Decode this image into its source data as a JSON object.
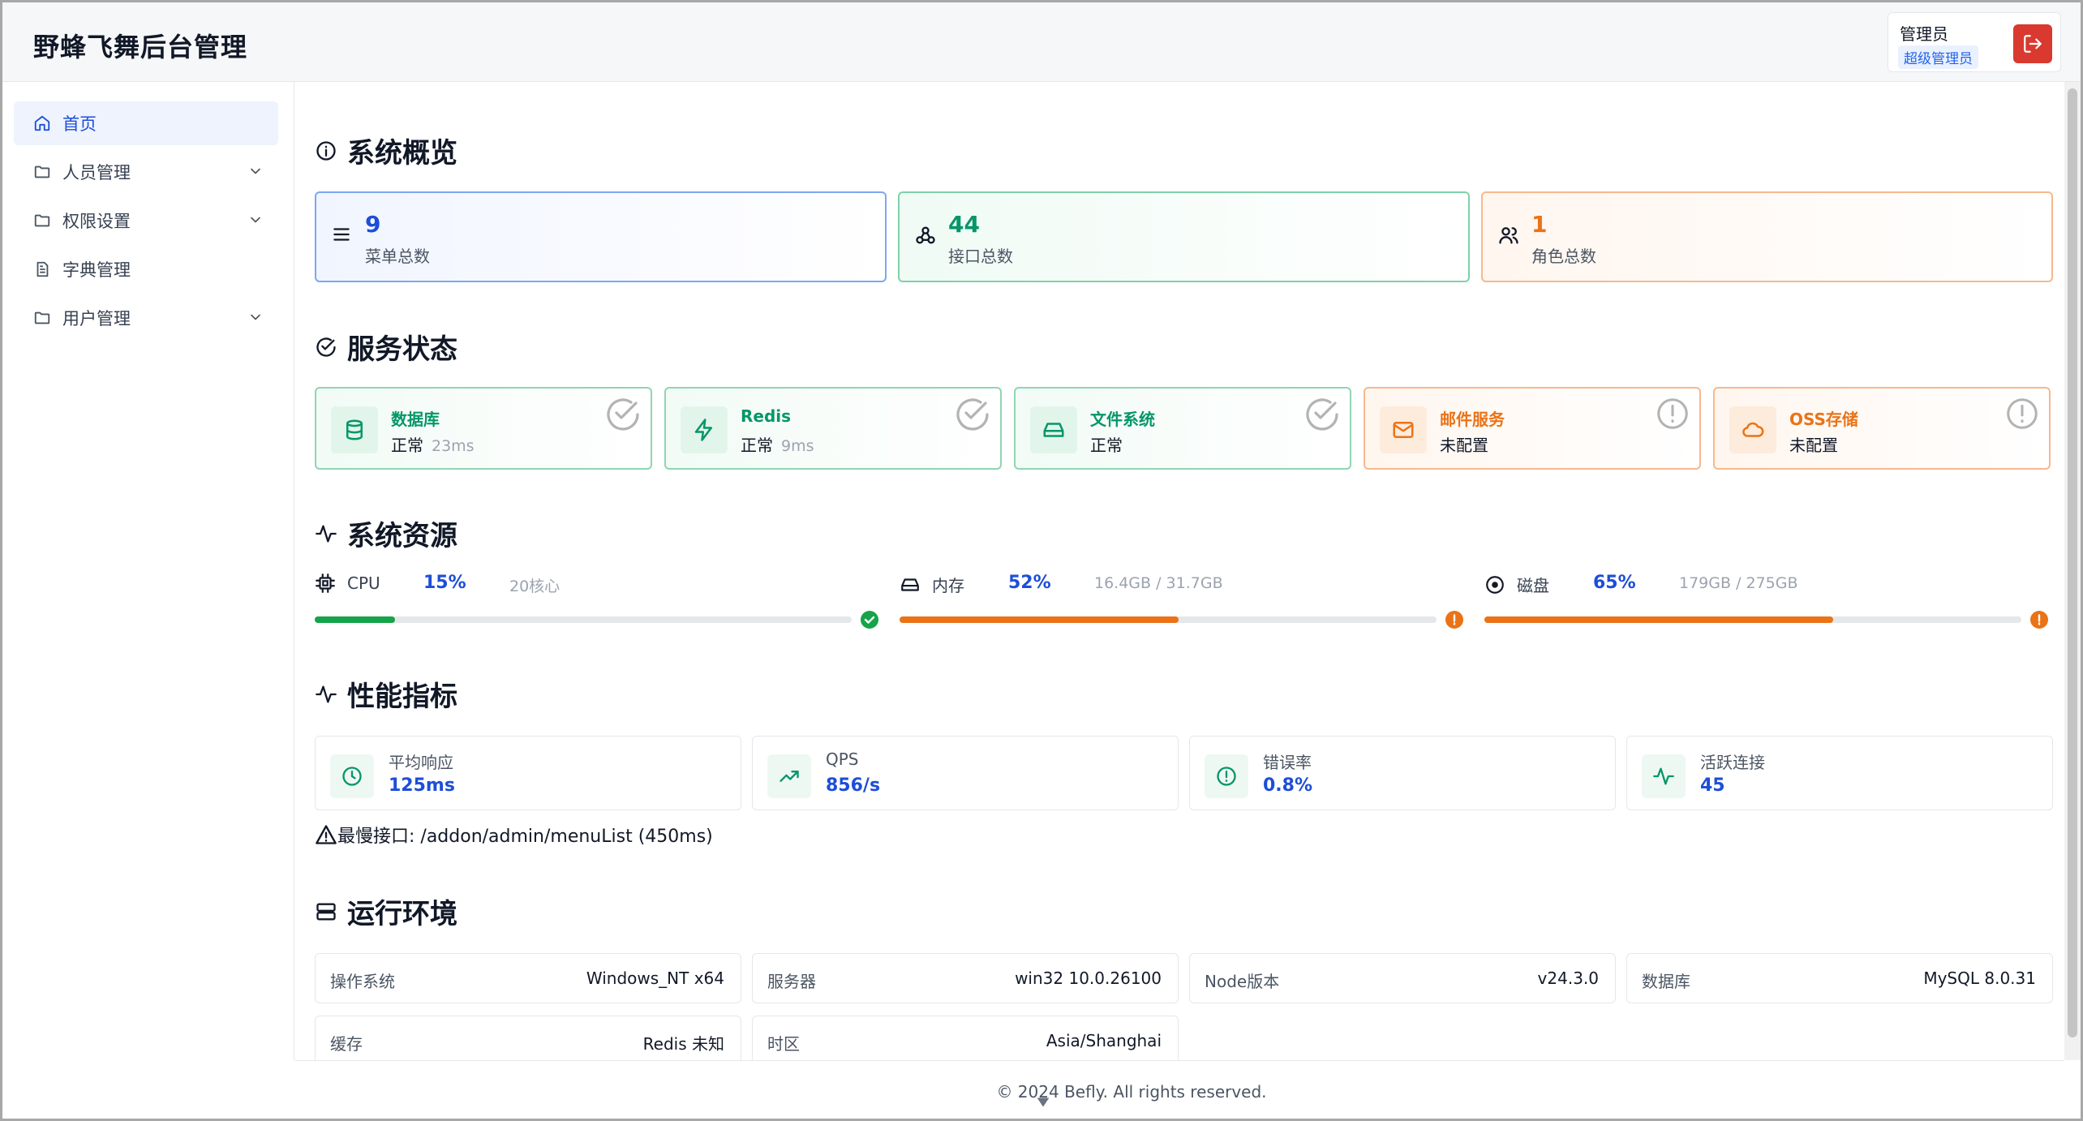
{
  "header": {
    "title": "野蜂飞舞后台管理",
    "user_name": "管理员",
    "user_role": "超级管理员"
  },
  "sidebar": {
    "items": [
      {
        "label": "首页"
      },
      {
        "label": "人员管理"
      },
      {
        "label": "权限设置"
      },
      {
        "label": "字典管理"
      },
      {
        "label": "用户管理"
      }
    ]
  },
  "overview": {
    "title": "系统概览",
    "cards": [
      {
        "value": "9",
        "label": "菜单总数"
      },
      {
        "value": "44",
        "label": "接口总数"
      },
      {
        "value": "1",
        "label": "角色总数"
      }
    ]
  },
  "services": {
    "title": "服务状态",
    "cards": [
      {
        "name": "数据库",
        "status": "正常",
        "latency": "23ms"
      },
      {
        "name": "Redis",
        "status": "正常",
        "latency": "9ms"
      },
      {
        "name": "文件系统",
        "status": "正常",
        "latency": ""
      },
      {
        "name": "邮件服务",
        "status": "未配置",
        "latency": ""
      },
      {
        "name": "OSS存储",
        "status": "未配置",
        "latency": ""
      }
    ]
  },
  "resources": {
    "title": "系统资源",
    "items": [
      {
        "label": "CPU",
        "percent_text": "15%",
        "percent": 15,
        "detail": "20核心",
        "color": "#16a34a"
      },
      {
        "label": "内存",
        "percent_text": "52%",
        "percent": 52,
        "detail": "16.4GB / 31.7GB",
        "color": "#ea7317"
      },
      {
        "label": "磁盘",
        "percent_text": "65%",
        "percent": 65,
        "detail": "179GB / 275GB",
        "color": "#ea7317"
      }
    ]
  },
  "performance": {
    "title": "性能指标",
    "cards": [
      {
        "label": "平均响应",
        "value": "125ms"
      },
      {
        "label": "QPS",
        "value": "856/s"
      },
      {
        "label": "错误率",
        "value": "0.8%"
      },
      {
        "label": "活跃连接",
        "value": "45"
      }
    ],
    "slowest": "最慢接口: /addon/admin/menuList (450ms)"
  },
  "environment": {
    "title": "运行环境",
    "items": [
      {
        "key": "操作系统",
        "value": "Windows_NT x64"
      },
      {
        "key": "服务器",
        "value": "win32 10.0.26100"
      },
      {
        "key": "Node版本",
        "value": "v24.3.0"
      },
      {
        "key": "数据库",
        "value": "MySQL 8.0.31"
      },
      {
        "key": "缓存",
        "value": "Redis 未知"
      },
      {
        "key": "时区",
        "value": "Asia/Shanghai"
      }
    ]
  },
  "footer": {
    "text": "© 2024 Befly. All rights reserved."
  },
  "colors": {
    "primary": "#1d4ed8",
    "success": "#16a34a",
    "warning": "#ea7317",
    "danger": "#d9392f"
  }
}
